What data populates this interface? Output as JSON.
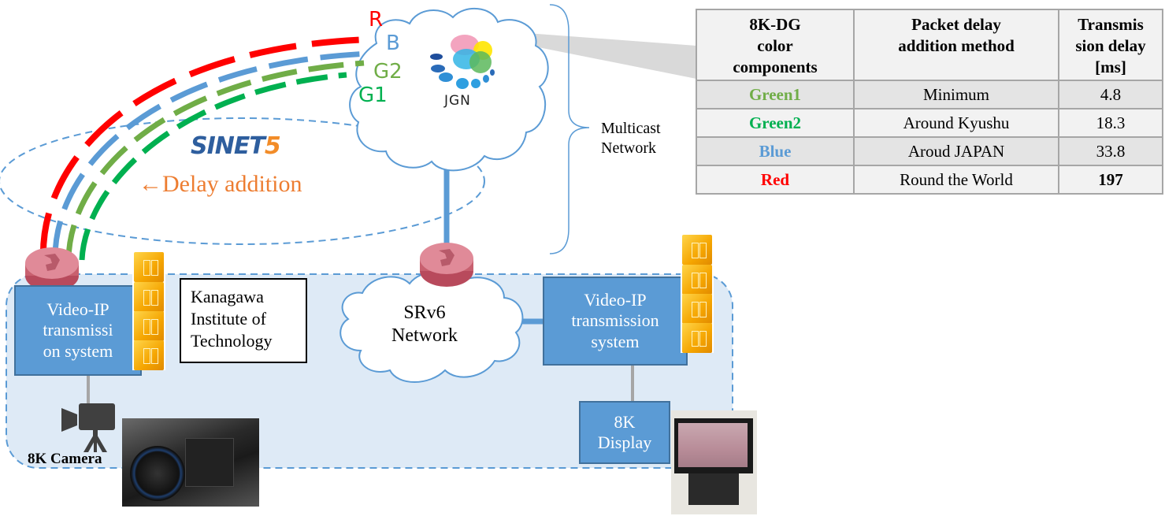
{
  "streams": [
    {
      "label": "R",
      "name": "Red",
      "color": "#ff0000"
    },
    {
      "label": "B",
      "name": "Blue",
      "color": "#5b9bd5"
    },
    {
      "label": "G2",
      "name": "Green2",
      "color": "#70ad47"
    },
    {
      "label": "G1",
      "name": "Green1",
      "color": "#00b050"
    }
  ],
  "jgn": {
    "label": "JGN"
  },
  "sinet": {
    "logo_main": "SINET",
    "logo_num": "5"
  },
  "delay_label": "←Delay addition",
  "multicast": {
    "line1": "Multicast",
    "line2": "Network"
  },
  "table": {
    "headers": [
      {
        "l1": "8K-DG",
        "l2": "color",
        "l3": "components"
      },
      {
        "l1": "Packet delay",
        "l2": "addition method",
        "l3": ""
      },
      {
        "l1": "Transmis",
        "l2": "sion delay",
        "l3": "[ms]"
      }
    ],
    "rows": [
      {
        "component": "Green1",
        "color": "#70ad47",
        "method": "Minimum",
        "delay": "4.8",
        "bold": false
      },
      {
        "component": "Green2",
        "color": "#00b050",
        "method": "Around Kyushu",
        "delay": "18.3",
        "bold": false
      },
      {
        "component": "Blue",
        "color": "#5b9bd5",
        "method": "Aroud JAPAN",
        "delay": "33.8",
        "bold": false
      },
      {
        "component": "Red",
        "color": "#ff0000",
        "method": "Round the World",
        "delay": "197",
        "bold": true
      }
    ]
  },
  "left_site": {
    "system": {
      "l1": "Video-IP",
      "l2": "transmissi",
      "l3": "on system"
    },
    "institute": {
      "l1": "Kanagawa",
      "l2": "Institute of",
      "l3": "Technology"
    },
    "camera_label": "8K Camera"
  },
  "srv6": {
    "l1": "SRv6",
    "l2": "Network"
  },
  "right_site": {
    "system": {
      "l1": "Video-IP",
      "l2": "transmission",
      "l3": "system"
    },
    "display": {
      "l1": "8K",
      "l2": "Display"
    }
  },
  "colors": {
    "blue_box": "#5b9bd5",
    "region_fill": "#deeaf6",
    "dash": "#5b9bd5",
    "orange": "#ed7d31"
  }
}
